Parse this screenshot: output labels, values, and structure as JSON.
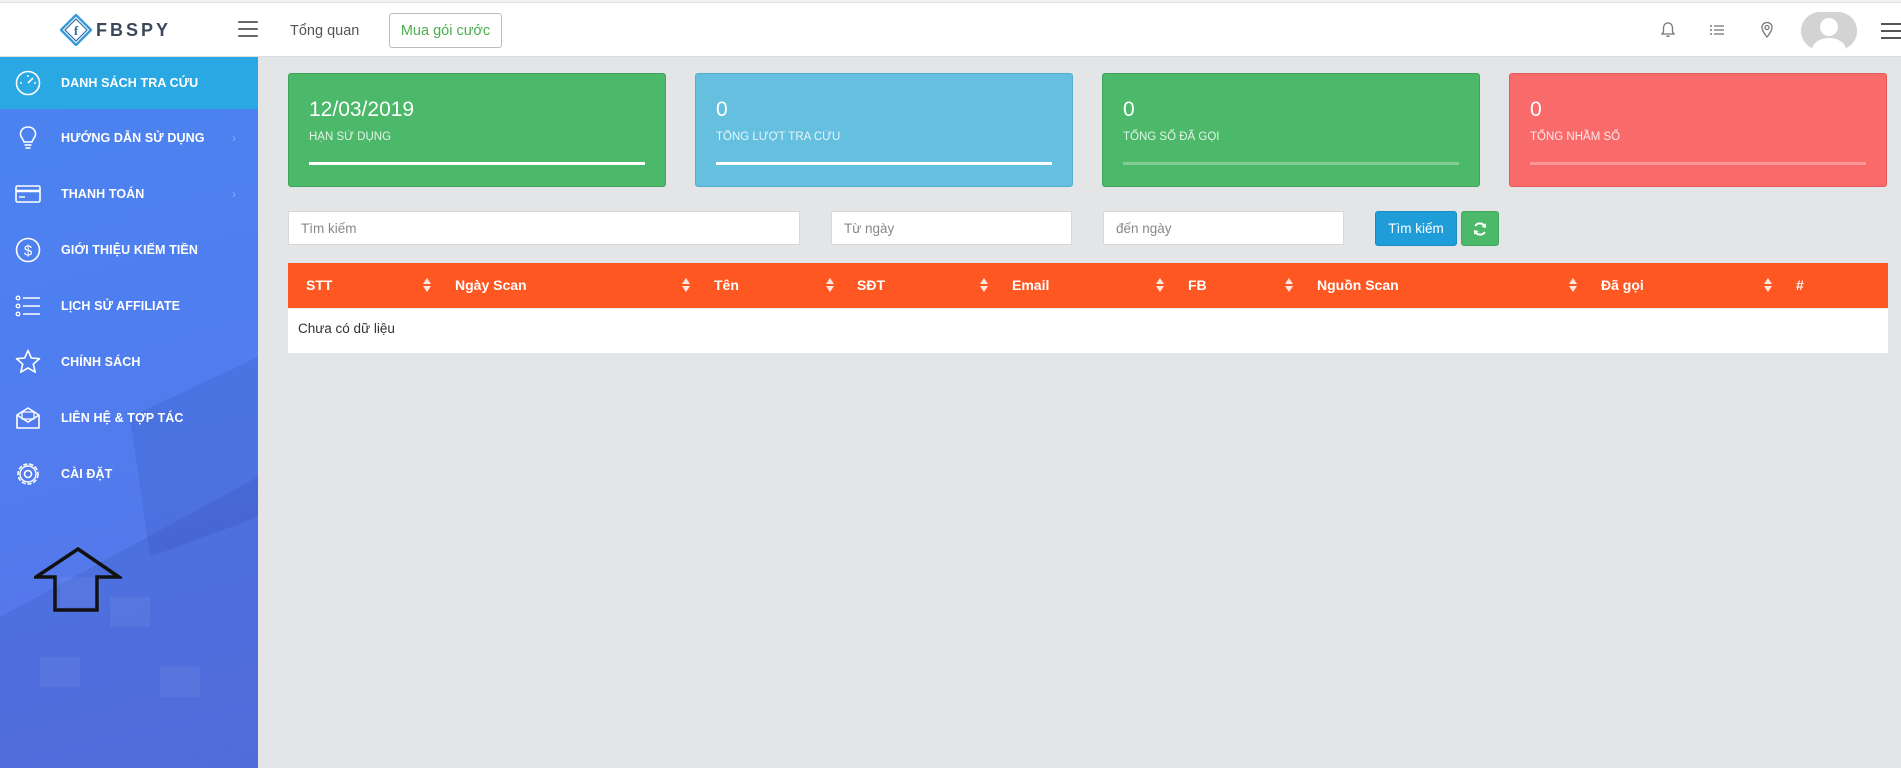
{
  "brand": {
    "name": "FBSPY"
  },
  "header": {
    "nav_overview": "Tổng quan",
    "buy_button": "Mua gói cước",
    "icons": [
      "bell-icon",
      "list-icon",
      "location-pin-icon",
      "avatar",
      "menu-icon"
    ]
  },
  "sidebar": {
    "items": [
      {
        "label": "DANH SÁCH TRA CỨU",
        "icon": "speedometer-icon",
        "active": true
      },
      {
        "label": "HƯỚNG DẪN SỬ DỤNG",
        "icon": "lightbulb-icon",
        "has_submenu": true
      },
      {
        "label": "THANH TOÁN",
        "icon": "credit-card-icon",
        "has_submenu": true
      },
      {
        "label": "GIỚI THIỆU KIẾM TIỀN",
        "icon": "dollar-icon"
      },
      {
        "label": "LỊCH SỬ AFFILIATE",
        "icon": "list-icon"
      },
      {
        "label": "CHÍNH SÁCH",
        "icon": "star-icon"
      },
      {
        "label": "LIÊN HỆ & TỢP TÁC",
        "icon": "envelope-icon"
      },
      {
        "label": "CÀI ĐẶT",
        "icon": "gear-icon"
      }
    ]
  },
  "cards": [
    {
      "value": "12/03/2019",
      "label": "HẠN SỬ DỤNG",
      "color": "#4cb86a",
      "progress": 1.0
    },
    {
      "value": "0",
      "label": "TỔNG LƯỢT TRA CỨU",
      "color": "#5bc0de",
      "progress": 1.0
    },
    {
      "value": "0",
      "label": "TỔNG SỐ ĐÃ GỌI",
      "color": "#4cb86a",
      "progress": 0.0
    },
    {
      "value": "0",
      "label": "TỔNG NHẦM SỐ",
      "color": "#f96868",
      "progress": 0.0
    }
  ],
  "search": {
    "keyword_placeholder": "Tìm kiếm",
    "from_placeholder": "Từ ngày",
    "to_placeholder": "đến ngày",
    "search_button": "Tìm kiếm"
  },
  "table": {
    "columns": [
      "STT",
      "Ngày Scan",
      "Tên",
      "SĐT",
      "Email",
      "FB",
      "Nguồn Scan",
      "Đã gọi",
      "#"
    ],
    "empty_text": "Chưa có dữ liệu",
    "header_color": "#ff5722"
  }
}
